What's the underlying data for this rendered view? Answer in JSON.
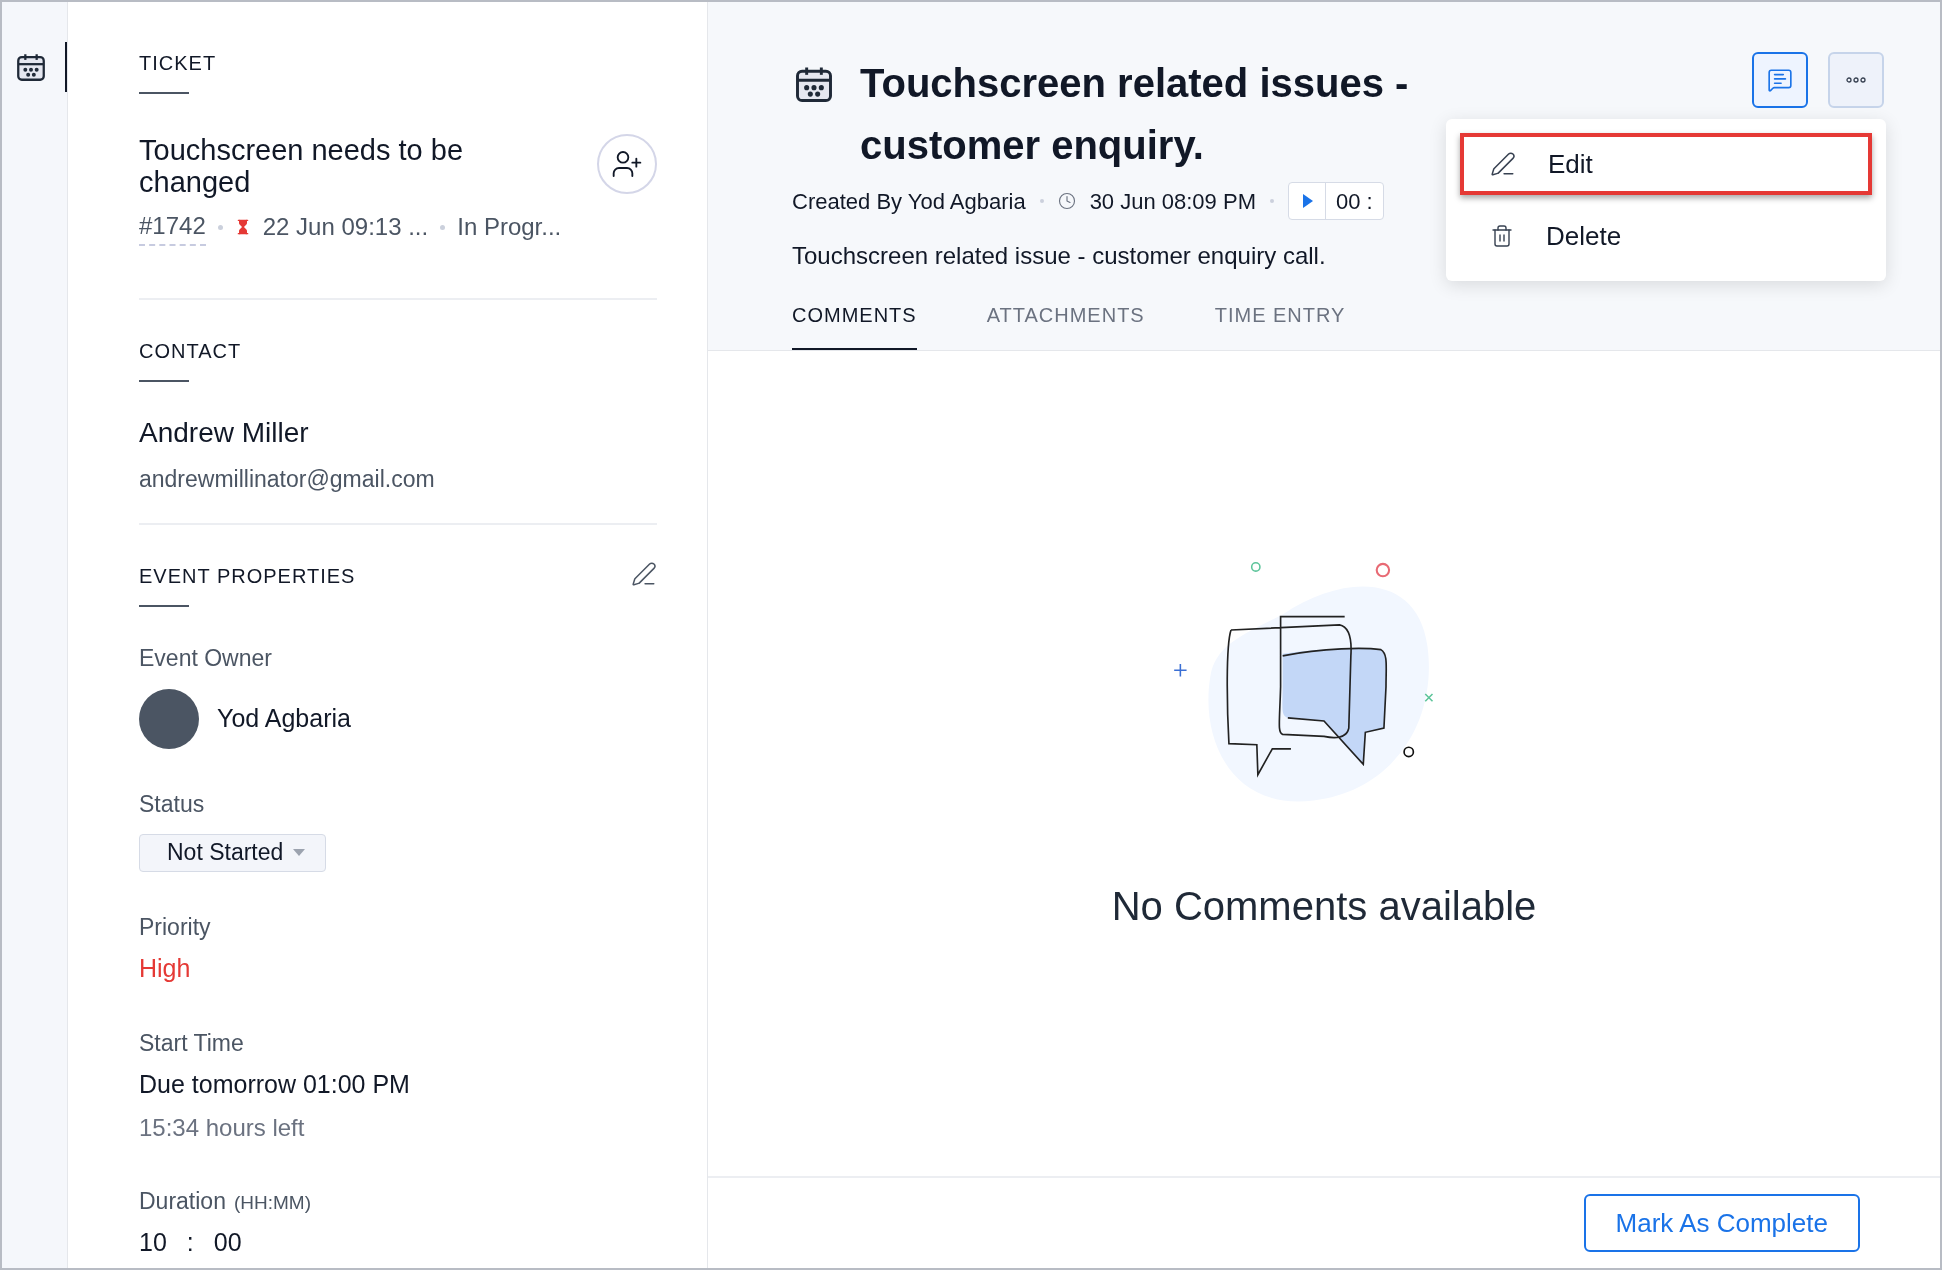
{
  "rail": {
    "items": [
      {
        "kind": "calendar",
        "selected": true
      }
    ]
  },
  "ticket": {
    "heading": "TICKET",
    "title": "Touchscreen needs to be changed",
    "number": "#1742",
    "due": "22 Jun 09:13 ...",
    "status": "In Progr..."
  },
  "contact": {
    "heading": "CONTACT",
    "name": "Andrew Miller",
    "email": "andrewmillinator@gmail.com"
  },
  "event_properties": {
    "heading": "EVENT PROPERTIES",
    "fields": [
      {
        "kind": "owner",
        "label": "Event Owner",
        "value": "Yod Agbaria"
      },
      {
        "kind": "dropdown",
        "label": "Status",
        "value": "Not Started"
      },
      {
        "kind": "priority",
        "label": "Priority",
        "value": "High"
      },
      {
        "kind": "time",
        "label": "Start Time",
        "value": "Due tomorrow 01:00 PM",
        "note": "15:34 hours left"
      },
      {
        "kind": "duration",
        "label": "Duration",
        "unit": "(HH:MM)",
        "hours": "10",
        "separator": ":",
        "minutes": "00"
      }
    ]
  },
  "event": {
    "title": "Touchscreen related issues - customer enquiry.",
    "created_by": "Created By Yod Agbaria",
    "created_at": "30 Jun 08:09 PM",
    "timer": "00 :",
    "description": "Touchscreen related issue - customer enquiry call."
  },
  "tabs": [
    {
      "label": "COMMENTS",
      "selected": true
    },
    {
      "label": "ATTACHMENTS",
      "selected": false
    },
    {
      "label": "TIME ENTRY",
      "selected": false
    }
  ],
  "empty_state": {
    "message": "No Comments available"
  },
  "menu": {
    "items": [
      {
        "kind": "edit",
        "label": "Edit",
        "highlighted": true
      },
      {
        "kind": "delete",
        "label": "Delete",
        "highlighted": false
      }
    ]
  },
  "footer": {
    "button": "Mark As Complete"
  }
}
